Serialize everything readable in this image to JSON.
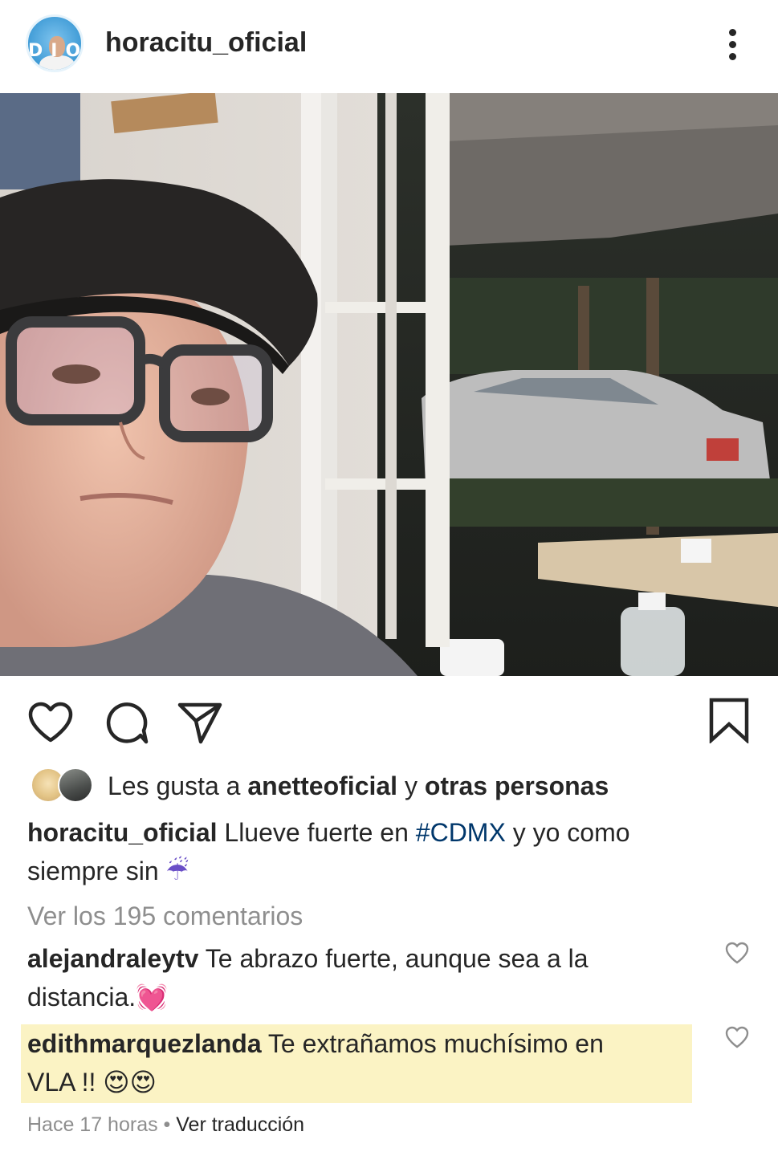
{
  "post": {
    "username": "horacitu_oficial",
    "avatar_text": "DIOS",
    "likes": {
      "prefix": "Les gusta a ",
      "user": "anetteoficial",
      "middle": " y ",
      "others": "otras personas"
    },
    "caption": {
      "username": "horacitu_oficial",
      "text_1": " Llueve fuerte en ",
      "hashtag": "#CDMX",
      "text_2": " y yo como",
      "line2": "siempre sin ",
      "emoji": "☔"
    },
    "view_comments": "Ver los 195 comentarios",
    "comments": [
      {
        "username": "alejandraleytv",
        "line1": " Te abrazo fuerte, aunque sea a la",
        "line2": "distancia.",
        "emoji": "💓"
      },
      {
        "username": "edithmarquezlanda",
        "line1": " Te extrañamos muchísimo en",
        "line2": "VLA !! ",
        "emoji": "😍😍"
      }
    ],
    "timestamp": "Hace 17 horas",
    "separator": " • ",
    "translate": "Ver traducción"
  },
  "icons": [
    "more-options-icon",
    "heart-icon",
    "comment-icon",
    "share-icon",
    "bookmark-icon",
    "comment-like-icon"
  ]
}
